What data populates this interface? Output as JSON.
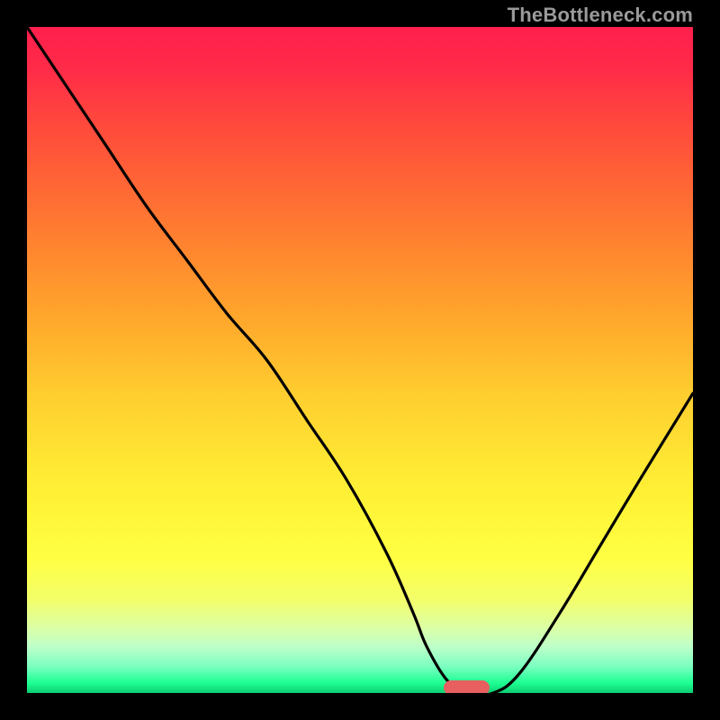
{
  "watermark": "TheBottleneck.com",
  "chart_data": {
    "type": "line",
    "title": "",
    "xlabel": "",
    "ylabel": "",
    "xlim": [
      0,
      100
    ],
    "ylim": [
      0,
      100
    ],
    "grid": false,
    "legend": false,
    "series": [
      {
        "name": "bottleneck-curve",
        "x": [
          0,
          6,
          12,
          18,
          24,
          30,
          36,
          42,
          48,
          54,
          58,
          60,
          63,
          66,
          70,
          74,
          80,
          86,
          92,
          100
        ],
        "y": [
          100,
          91,
          82,
          73,
          65,
          57,
          50,
          41,
          32,
          21,
          12,
          7,
          2,
          0,
          0,
          3,
          12,
          22,
          32,
          45
        ]
      }
    ],
    "marker": {
      "x_center": 66,
      "y_center": 0.8,
      "width": 7,
      "height": 2.2,
      "color": "#e75f5f"
    },
    "background_gradient": {
      "stops": [
        {
          "offset": 0.0,
          "color": "#ff1f4d"
        },
        {
          "offset": 0.06,
          "color": "#ff2a48"
        },
        {
          "offset": 0.15,
          "color": "#ff4a3c"
        },
        {
          "offset": 0.25,
          "color": "#ff6a34"
        },
        {
          "offset": 0.35,
          "color": "#ff8b2e"
        },
        {
          "offset": 0.45,
          "color": "#ffab2c"
        },
        {
          "offset": 0.55,
          "color": "#ffcd2f"
        },
        {
          "offset": 0.65,
          "color": "#ffe633"
        },
        {
          "offset": 0.72,
          "color": "#fff437"
        },
        {
          "offset": 0.8,
          "color": "#ffff44"
        },
        {
          "offset": 0.86,
          "color": "#f3ff6a"
        },
        {
          "offset": 0.9,
          "color": "#ddffa3"
        },
        {
          "offset": 0.93,
          "color": "#bfffc9"
        },
        {
          "offset": 0.96,
          "color": "#7bffc0"
        },
        {
          "offset": 0.985,
          "color": "#1dff92"
        },
        {
          "offset": 1.0,
          "color": "#0cce72"
        }
      ]
    }
  }
}
